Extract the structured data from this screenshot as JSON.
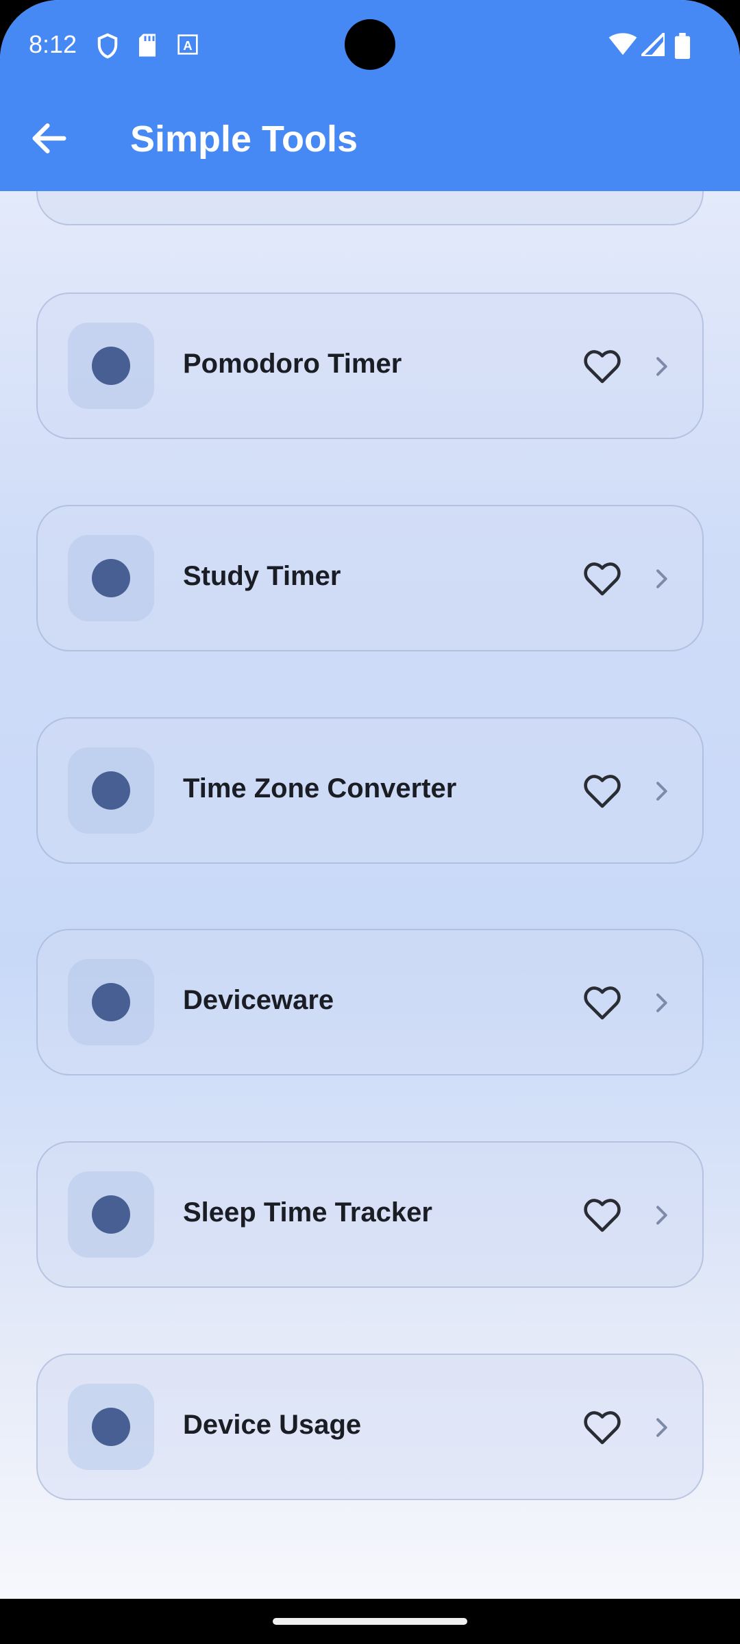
{
  "status_bar": {
    "time": "8:12",
    "icons": [
      "shield-icon",
      "sd-card-icon",
      "font-download-icon",
      "wifi-icon",
      "cell-signal-icon",
      "battery-icon"
    ]
  },
  "app_bar": {
    "back_icon": "arrow-back-icon",
    "title": "Simple Tools",
    "color": "#4688f4"
  },
  "tools": [
    {
      "label": "Pomodoro Timer",
      "favorite": false
    },
    {
      "label": "Study Timer",
      "favorite": false
    },
    {
      "label": "Time Zone Converter",
      "favorite": false
    },
    {
      "label": "Deviceware",
      "favorite": false
    },
    {
      "label": "Sleep Time Tracker",
      "favorite": false
    },
    {
      "label": "Device Usage",
      "favorite": false
    }
  ],
  "colors": {
    "icon_dot": "#475f92",
    "text": "#1b1d24"
  }
}
